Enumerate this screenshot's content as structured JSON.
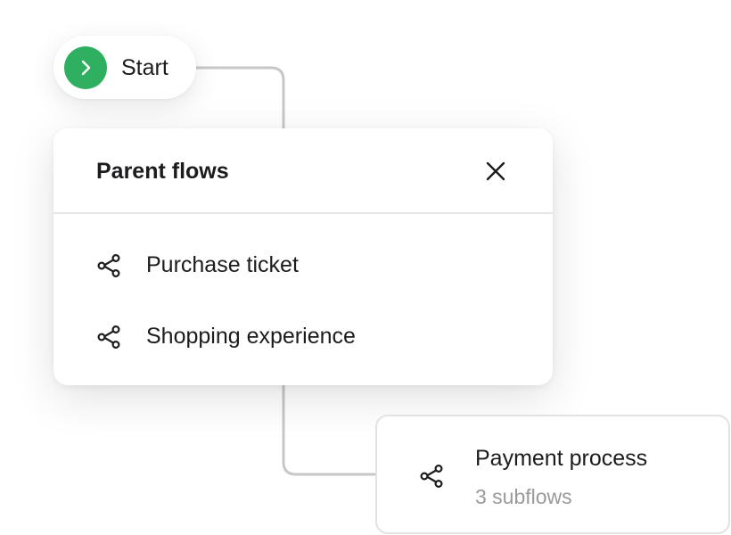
{
  "colors": {
    "start_accent": "#2fb060",
    "connector": "#c7c7c7",
    "muted_text": "#9a9a9a"
  },
  "start_node": {
    "label": "Start",
    "icon": "chevron-right-icon"
  },
  "parent_flows_popover": {
    "title": "Parent flows",
    "close_icon": "close-icon",
    "items": [
      {
        "label": "Purchase ticket",
        "icon": "flow-branch-icon"
      },
      {
        "label": "Shopping experience",
        "icon": "flow-branch-icon"
      }
    ]
  },
  "flow_node": {
    "title": "Payment process",
    "subtitle": "3 subflows",
    "icon": "flow-branch-icon"
  }
}
